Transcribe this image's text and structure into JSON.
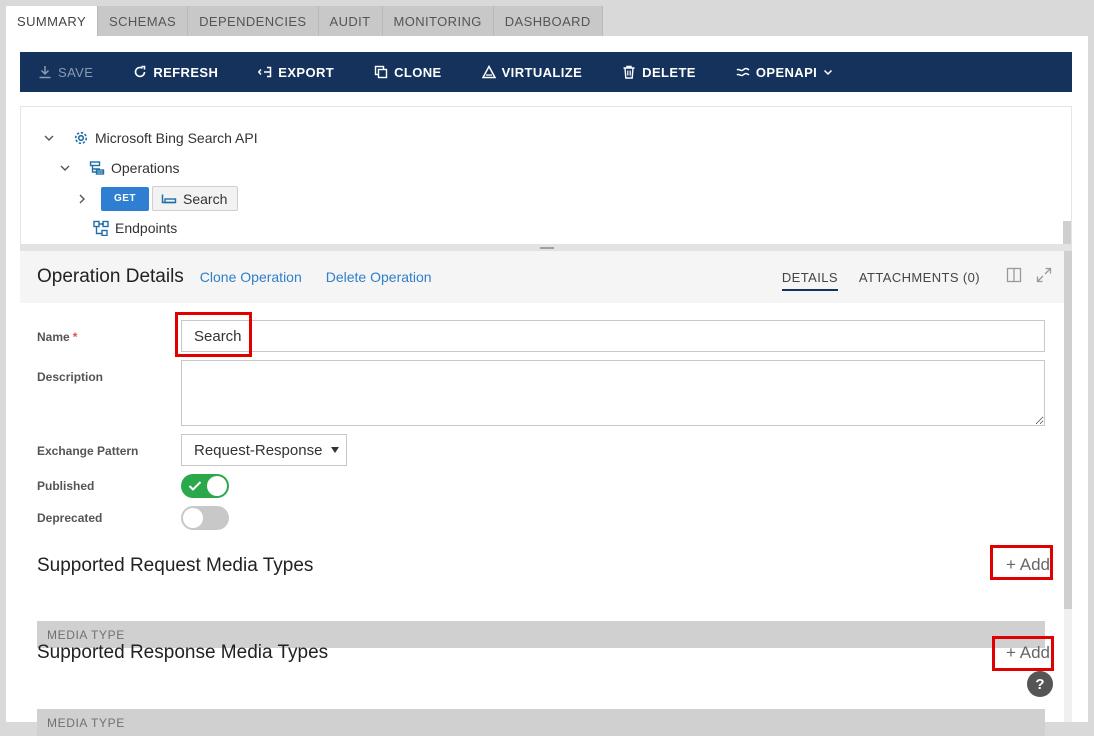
{
  "tabs": [
    {
      "label": "SUMMARY",
      "active": true
    },
    {
      "label": "SCHEMAS"
    },
    {
      "label": "DEPENDENCIES"
    },
    {
      "label": "AUDIT"
    },
    {
      "label": "MONITORING"
    },
    {
      "label": "DASHBOARD"
    }
  ],
  "toolbar": {
    "save": "SAVE",
    "refresh": "REFRESH",
    "export": "EXPORT",
    "clone": "CLONE",
    "virtualize": "VIRTUALIZE",
    "delete": "DELETE",
    "openapi": "OPENAPI"
  },
  "tree": {
    "api_name": "Microsoft Bing Search API",
    "operations": "Operations",
    "method": "GET",
    "operation": "Search",
    "endpoints": "Endpoints"
  },
  "details": {
    "title": "Operation Details",
    "clone_link": "Clone Operation",
    "delete_link": "Delete Operation",
    "tab_details": "DETAILS",
    "tab_attachments": "ATTACHMENTS (0)"
  },
  "form": {
    "name_label": "Name",
    "required_mark": "*",
    "name_value": "Search",
    "description_label": "Description",
    "description_value": "",
    "exchange_label": "Exchange Pattern",
    "exchange_value": "Request-Response",
    "published_label": "Published",
    "published": true,
    "deprecated_label": "Deprecated",
    "deprecated": false
  },
  "request_media": {
    "title": "Supported Request Media Types",
    "add": "+ Add",
    "column": "MEDIA TYPE"
  },
  "response_media": {
    "title": "Supported Response Media Types",
    "add": "+ Add",
    "column": "MEDIA TYPE"
  },
  "help": "?",
  "colors": {
    "toolbar_bg": "#14325c",
    "link": "#2f7fc9",
    "get_badge": "#2e7fd1",
    "toggle_on": "#2aa84a",
    "highlight": "#e00000"
  }
}
